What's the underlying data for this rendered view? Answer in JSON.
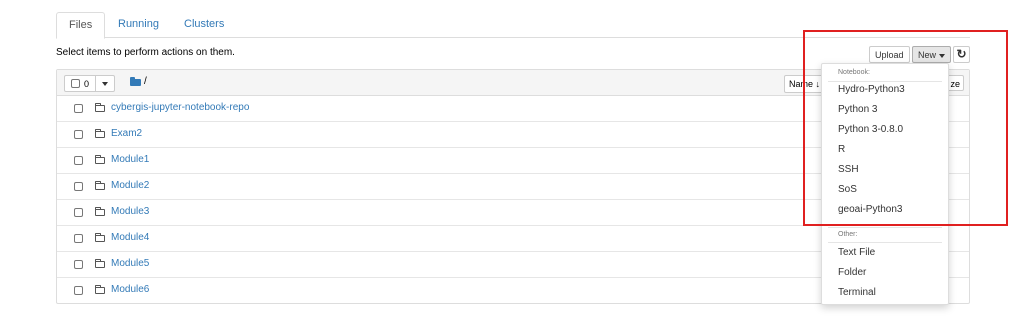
{
  "tabs": [
    {
      "label": "Files"
    },
    {
      "label": "Running"
    },
    {
      "label": "Clusters"
    }
  ],
  "notice": "Select items to perform actions on them.",
  "toolbar": {
    "upload_label": "Upload",
    "new_label": "New",
    "refresh_icon": "refresh-icon"
  },
  "list_header": {
    "selected_count": "0",
    "path": "/",
    "sort_name_label": "Name",
    "sort_size_label": "ze"
  },
  "files": [
    {
      "name": "cybergis-jupyter-notebook-repo"
    },
    {
      "name": "Exam2"
    },
    {
      "name": "Module1"
    },
    {
      "name": "Module2"
    },
    {
      "name": "Module3"
    },
    {
      "name": "Module4"
    },
    {
      "name": "Module5"
    },
    {
      "name": "Module6"
    }
  ],
  "new_menu": {
    "notebook_header": "Notebook:",
    "notebooks": [
      "Hydro-Python3",
      "Python 3",
      "Python 3-0.8.0",
      "R",
      "SSH",
      "SoS",
      "geoai-Python3"
    ],
    "other_header": "Other:",
    "other": [
      "Text File",
      "Folder",
      "Terminal"
    ]
  },
  "colors": {
    "link": "#337ab7",
    "highlight_box": "#e02020"
  }
}
